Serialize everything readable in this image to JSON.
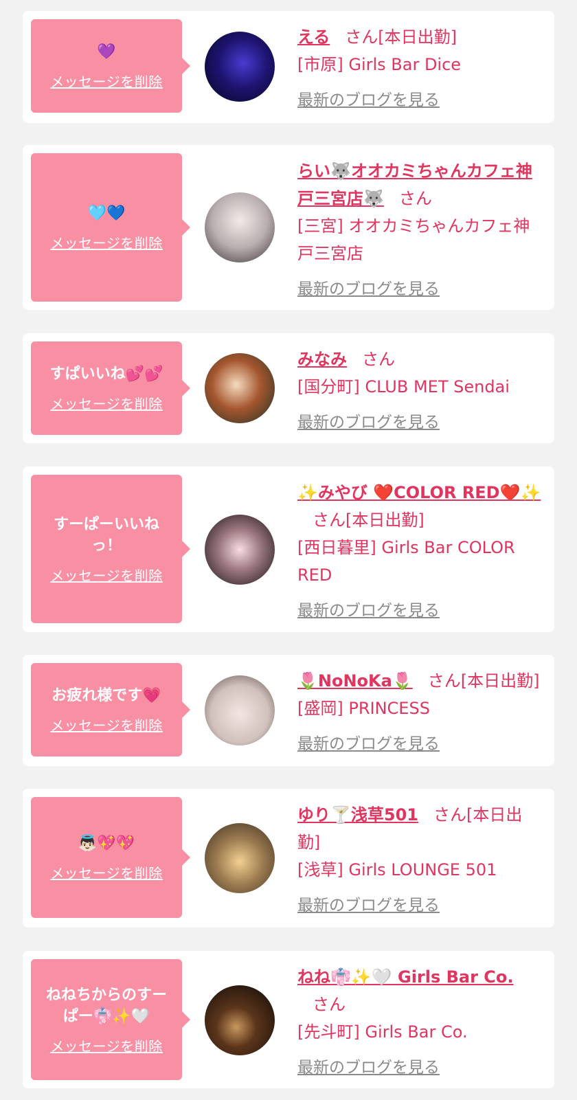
{
  "delete_label": "メッセージを削除",
  "blog_label": "最新のブログを見る",
  "san": "さん",
  "colors": {
    "accent": "#e0355f",
    "bubble": "#f98fa3",
    "background": "#f2f2f2",
    "link_gray": "#8a8a8a"
  },
  "cards": [
    {
      "message": "💜",
      "name": "える",
      "suffix": "[本日出勤]",
      "shop": "[市原] Girls Bar Dice",
      "avatar": "avatar-dark-purple"
    },
    {
      "message": "🩵💙",
      "name": "らい🐺オオカミちゃんカフェ神戸三宮店🐺",
      "suffix": "",
      "shop": "[三宮] オオカミちゃんカフェ神戸三宮店",
      "avatar": "avatar-girl-gray"
    },
    {
      "message": "すぱいいね💕💕",
      "name": "みなみ",
      "suffix": "",
      "shop": "[国分町] CLUB MET Sendai",
      "avatar": "avatar-girl-green"
    },
    {
      "message": "すーぱーいいね\nっ！",
      "name": "✨みやび ❤️COLOR RED❤️✨",
      "suffix": "[本日出勤]",
      "shop": "[西日暮里] Girls Bar COLOR RED",
      "avatar": "avatar-girl-dark"
    },
    {
      "message": "お疲れ様です💗",
      "name": "🌷NoNoKa🌷",
      "suffix": "[本日出勤]",
      "shop": "[盛岡] PRINCESS",
      "avatar": "avatar-girl-face"
    },
    {
      "message": "👼🏻💖💖",
      "name": "ゆり🍸浅草501",
      "suffix": "[本日出勤]",
      "shop": "[浅草] Girls LOUNGE 501",
      "avatar": "avatar-girl-lounge"
    },
    {
      "message": "ねねちからのすー\nぱー👘✨🤍",
      "name": "ねね👘✨🤍 Girls Bar Co.",
      "suffix": "",
      "shop": "[先斗町] Girls Bar Co.",
      "avatar": "avatar-bar-dark"
    }
  ]
}
